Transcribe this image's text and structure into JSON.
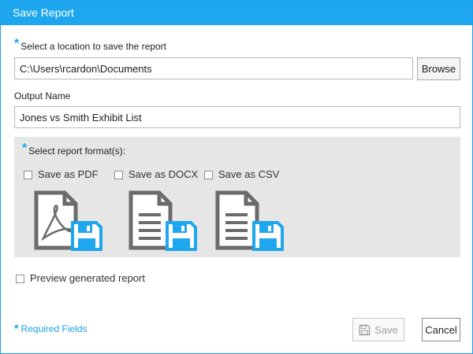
{
  "dialog": {
    "title": "Save Report"
  },
  "location": {
    "required_marker": "*",
    "label": "Select a location to save the report",
    "value": "C:\\Users\\rcardon\\Documents",
    "browse_label": "Browse"
  },
  "output_name": {
    "label": "Output Name",
    "value": "Jones vs Smith Exhibit List"
  },
  "formats": {
    "required_marker": "*",
    "label": "Select report format(s):",
    "options": [
      {
        "label": "Save as PDF",
        "checked": false,
        "icon": "pdf-file-save-icon"
      },
      {
        "label": "Save as DOCX",
        "checked": false,
        "icon": "docx-file-save-icon"
      },
      {
        "label": "Save as CSV",
        "checked": false,
        "icon": "csv-file-save-icon"
      }
    ]
  },
  "preview": {
    "label": "Preview generated report",
    "checked": false
  },
  "footer": {
    "required_marker": "*",
    "required_text": "Required Fields",
    "save_label": "Save",
    "cancel_label": "Cancel"
  },
  "colors": {
    "accent": "#1ea7ee",
    "file_icon": "#6b6b6b",
    "disk_icon": "#1ea7ee"
  }
}
